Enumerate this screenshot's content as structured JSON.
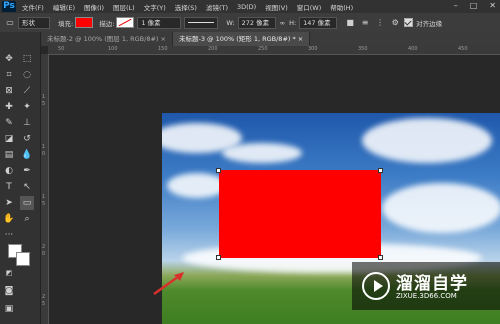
{
  "menubar": {
    "logo": "Ps",
    "items": [
      "文件(F)",
      "编辑(E)",
      "图像(I)",
      "图层(L)",
      "文字(Y)",
      "选择(S)",
      "滤镜(T)",
      "3D(D)",
      "视图(V)",
      "窗口(W)",
      "帮助(H)"
    ],
    "window_controls": [
      "–",
      "□",
      "✕"
    ]
  },
  "options": {
    "mode": "形状",
    "fill_label": "填充:",
    "fill_color": "#ff0000",
    "stroke_label": "描边:",
    "stroke_width": "1 像素",
    "w_label": "W:",
    "w_value": "272 像素",
    "link_icon": "∞",
    "h_label": "H:",
    "h_value": "147 像素",
    "align_edges_label": "对齐边缘"
  },
  "tabs": [
    {
      "label": "未标题-2 @ 100% (图层 1, RGB/8#) ×",
      "active": false
    },
    {
      "label": "未标题-3 @ 100% (矩形 1, RGB/8#) * ×",
      "active": true
    }
  ],
  "ruler_top": [
    "50",
    "100",
    "150",
    "200",
    "250",
    "300",
    "350",
    "400",
    "450"
  ],
  "ruler_left": [
    "1",
    "5",
    "1",
    "0",
    "1",
    "5",
    "2",
    "0",
    "2",
    "5"
  ],
  "canvas": {
    "shape_color": "#fe0000"
  },
  "watermark": {
    "title": "溜溜自学",
    "url": "ZIXUE.3D66.COM"
  }
}
